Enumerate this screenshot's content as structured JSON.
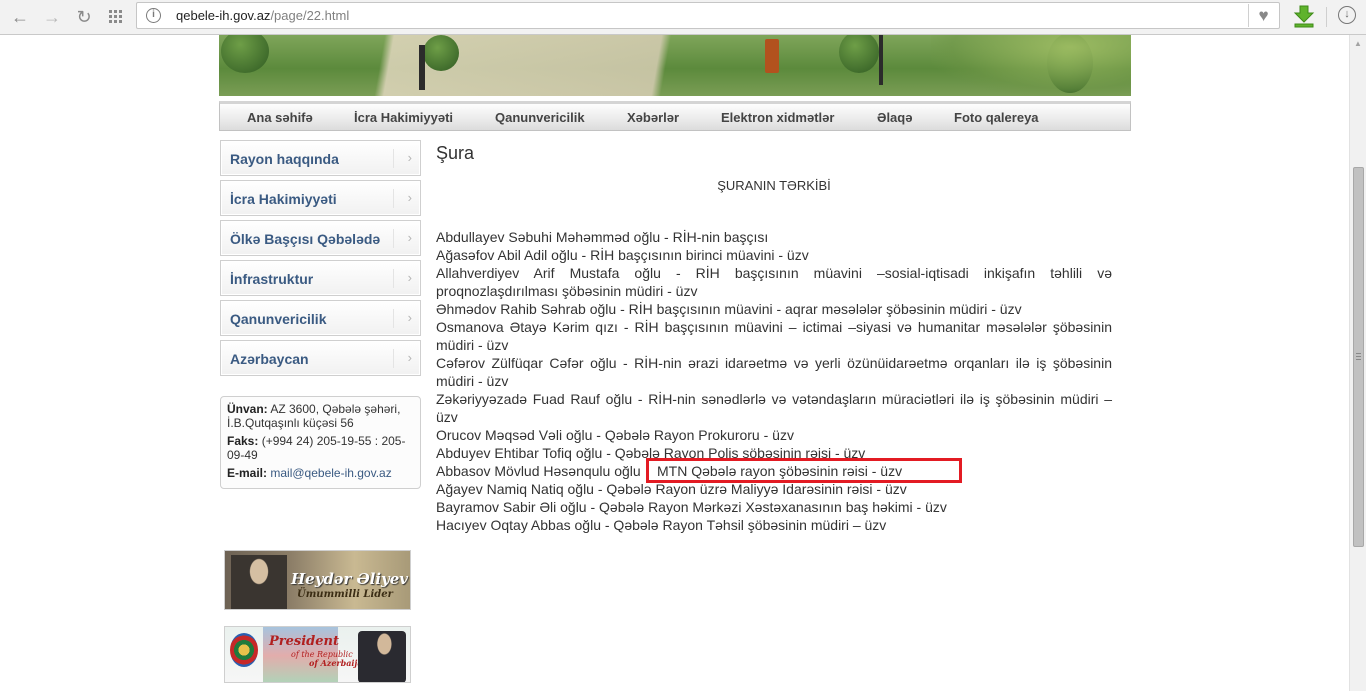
{
  "browser": {
    "url_host": "qebele-ih.gov.az",
    "url_path": "/page/22.html"
  },
  "topnav": [
    "Ana səhifə",
    "İcra Hakimiyyəti",
    "Qanunvericilik",
    "Xəbərlər",
    "Elektron xidmətlər",
    "Əlaqə",
    "Foto qalereya"
  ],
  "sidebar": [
    "Rayon haqqında",
    "İcra Hakimiyyəti",
    "Ölkə Başçısı Qəbələdə",
    "İnfrastruktur",
    "Qanunvericilik",
    "Azərbaycan"
  ],
  "contact": {
    "address_label": "Ünvan:",
    "address": "AZ 3600, Qəbələ şəhəri, İ.B.Qutqaşınlı küçəsi 56",
    "fax_label": "Faks:",
    "fax": "(+994 24) 205-19-55 : 205-09-49",
    "email_label": "E-mail:",
    "email": "mail@qebele-ih.gov.az"
  },
  "banners": {
    "heydar_title": "Heydər Əliyev",
    "heydar_subtitle": "Ümummilli Lider",
    "president_title": "President",
    "president_line2": "of the Republic",
    "president_line3": "of Azerbaijan"
  },
  "main": {
    "title": "Şura",
    "subtitle": "ŞURANIN TƏRKİBİ",
    "members": [
      "Abdullayev Səbuhi Məhəmməd oğlu - RİH-nin başçısı",
      "Ağasəfov Abil Adil oğlu - RİH başçısının birinci müavini - üzv",
      "Allahverdiyev Arif Mustafa oğlu - RİH başçısının müavini –sosial-iqtisadi inkişafın təhlili və proqnozlaşdırılması şöbəsinin müdiri - üzv",
      "Əhmədov Rahib Səhrab oğlu - RİH başçısının müavini - aqrar məsələlər şöbəsinin müdiri - üzv",
      "Osmanova Ətayə Kərim qızı - RİH başçısının müavini – ictimai –siyasi və humanitar məsələlər şöbəsinin müdiri - üzv",
      "Cəfərov Zülfüqar Cəfər oğlu - RİH-nin ərazi idarəetmə və yerli özünüidarəetmə orqanları ilə iş şöbəsinin müdiri - üzv",
      "Zəkəriyyəzadə Fuad Rauf oğlu - RİH-nin sənədlərlə və vətəndaşların müraciətləri ilə iş şöbəsinin müdiri – üzv",
      "Orucov Məqsəd Vəli oğlu - Qəbələ Rayon Prokuroru - üzv",
      "Abduyev Ehtibar Tofiq oğlu - Qəbələ Rayon Polis şöbəsinin rəisi - üzv",
      "Abbasov Mövlud Həsənqulu oğlu",
      "Ağayev Namiq Natiq oğlu - Qəbələ Rayon üzrə Maliyyə İdarəsinin rəisi - üzv",
      "Bayramov Sabir Əli oğlu - Qəbələ Rayon Mərkəzi Xəstəxanasının baş həkimi - üzv",
      "Hacıyev Oqtay Abbas oğlu - Qəbələ Rayon Təhsil şöbəsinin müdiri – üzv"
    ],
    "highlighted": "MTN Qəbələ rayon şöbəsinin rəisi - üzv"
  }
}
